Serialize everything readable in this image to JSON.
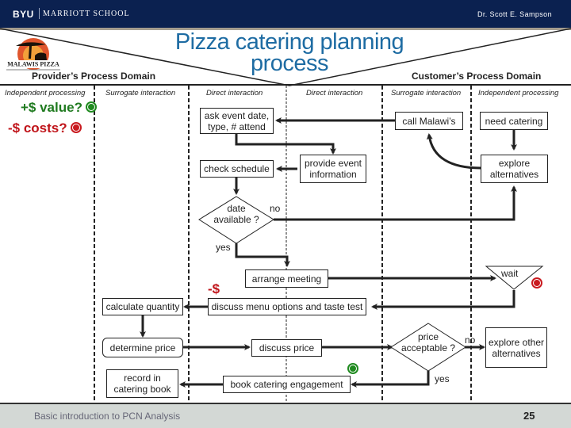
{
  "header": {
    "brand": "BYU",
    "school": "MARRIOTT SCHOOL",
    "author": "Dr. Scott E. Sampson"
  },
  "title": "Pizza catering planning process",
  "logo": {
    "text": "MALAWIS PIZZA"
  },
  "domains": {
    "provider": "Provider’s Process Domain",
    "customer": "Customer’s Process Domain"
  },
  "columns": [
    "Independent processing",
    "Surrogate interaction",
    "Direct interaction",
    "Direct interaction",
    "Surrogate interaction",
    "Independent processing"
  ],
  "legend": {
    "value": "+$ value?",
    "costs": "-$ costs?"
  },
  "steps": {
    "need_catering": "need catering",
    "call_malawis": "call Malawi’s",
    "ask_event": "ask event date, type, # attend",
    "explore_alternatives": "explore alternatives",
    "provide_event_info": "provide event information",
    "check_schedule": "check schedule",
    "date_available": "date available ?",
    "no1": "no",
    "yes1": "yes",
    "arrange_meeting": "arrange meeting",
    "wait": "wait",
    "cost_marker": "-$",
    "discuss_menu": "discuss menu options and taste test",
    "calculate_quantity": "calculate quantity",
    "determine_price": "determine price",
    "discuss_price": "discuss price",
    "price_acceptable": "price acceptable ?",
    "no2": "no",
    "yes2": "yes",
    "explore_other": "explore other alternatives",
    "record_catering": "record in catering book",
    "book_engagement": "book catering engagement"
  },
  "footer": {
    "text": "Basic introduction to PCN Analysis",
    "page": "25"
  }
}
